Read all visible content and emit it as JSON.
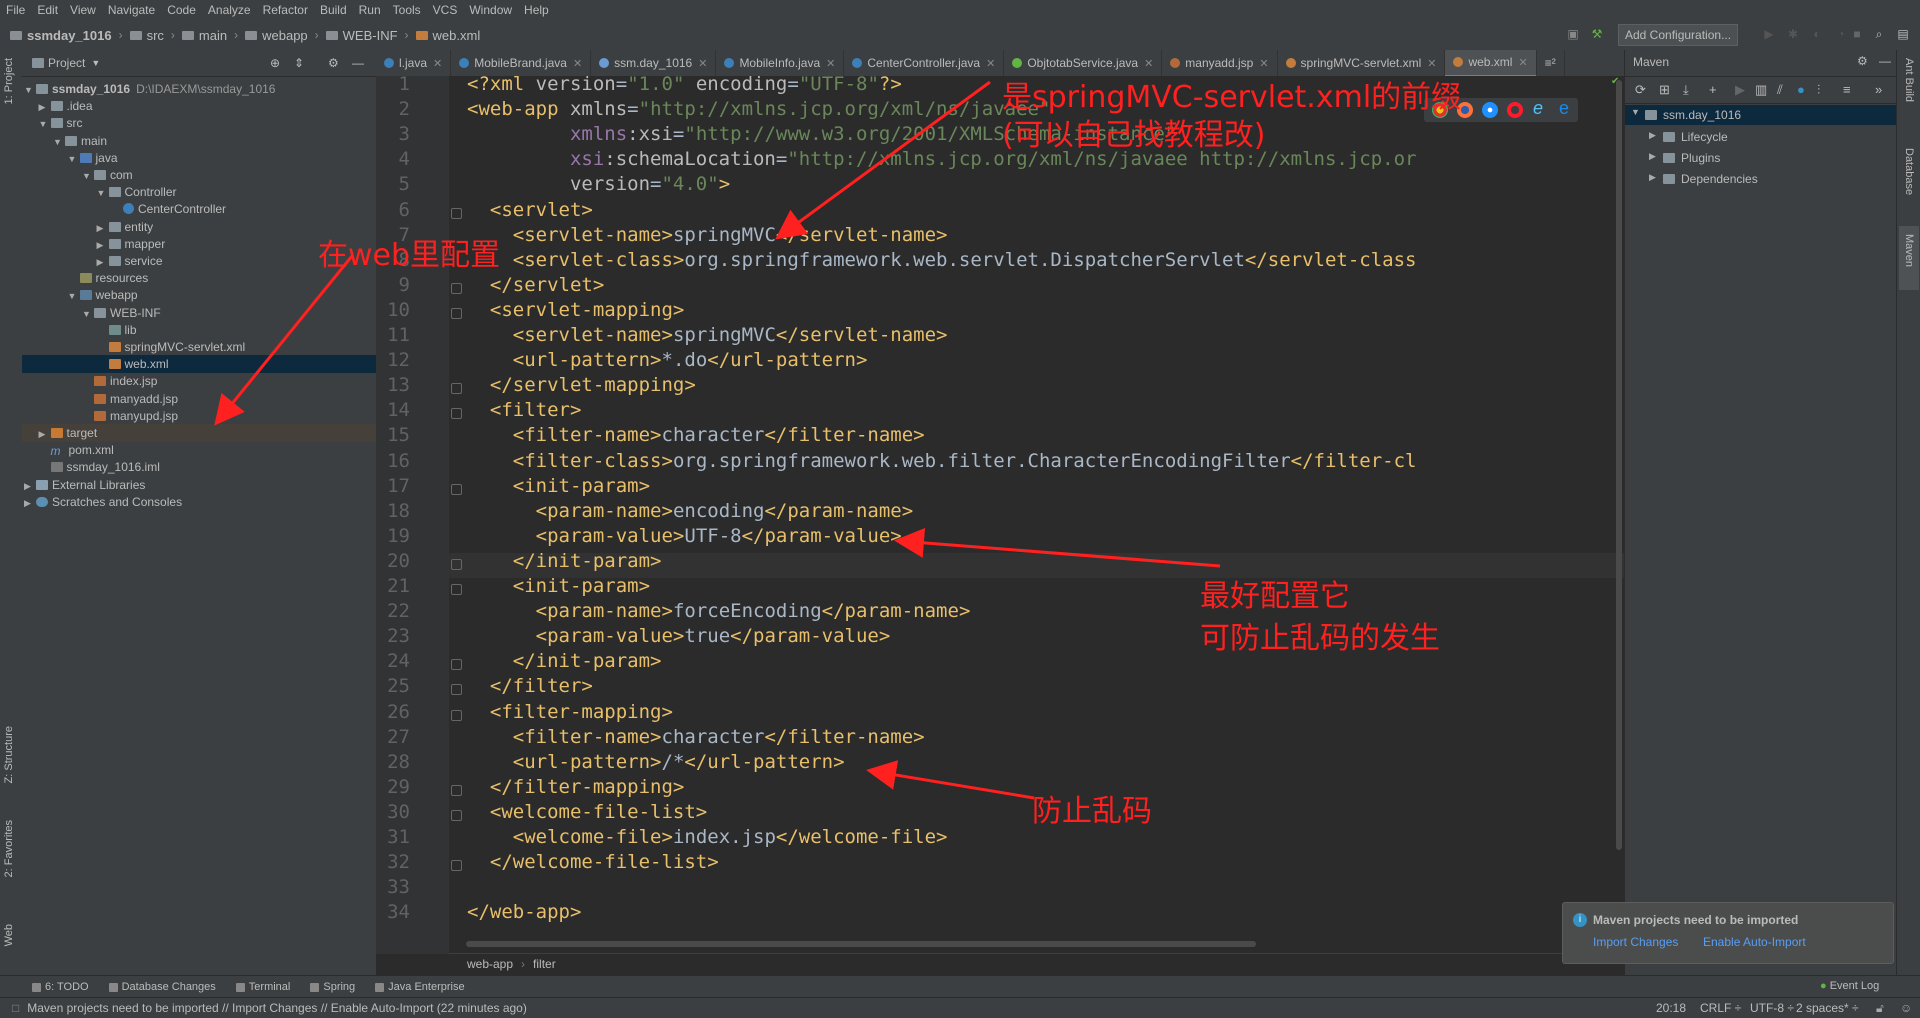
{
  "menu": [
    "File",
    "Edit",
    "View",
    "Navigate",
    "Code",
    "Analyze",
    "Refactor",
    "Build",
    "Run",
    "Tools",
    "VCS",
    "Window",
    "Help"
  ],
  "nav": {
    "project": "ssmday_1016",
    "crumbs": [
      "src",
      "main",
      "webapp",
      "WEB-INF",
      "web.xml"
    ],
    "add_config": "Add Configuration..."
  },
  "project_panel": {
    "title": "Project",
    "tree": [
      {
        "label": "ssmday_1016",
        "extra": "D:\\IDAEXM\\ssmday_1016",
        "depth": 0,
        "arrow": "▼",
        "icon": "folder",
        "bold": true
      },
      {
        "label": ".idea",
        "depth": 1,
        "arrow": "▶",
        "icon": "folder"
      },
      {
        "label": "src",
        "depth": 1,
        "arrow": "▼",
        "icon": "folder"
      },
      {
        "label": "main",
        "depth": 2,
        "arrow": "▼",
        "icon": "folder"
      },
      {
        "label": "java",
        "depth": 3,
        "arrow": "▼",
        "icon": "src"
      },
      {
        "label": "com",
        "depth": 4,
        "arrow": "▼",
        "icon": "folder"
      },
      {
        "label": "Controller",
        "depth": 5,
        "arrow": "▼",
        "icon": "folder"
      },
      {
        "label": "CenterController",
        "depth": 6,
        "arrow": "",
        "icon": "class"
      },
      {
        "label": "entity",
        "depth": 5,
        "arrow": "▶",
        "icon": "folder"
      },
      {
        "label": "mapper",
        "depth": 5,
        "arrow": "▶",
        "icon": "folder"
      },
      {
        "label": "service",
        "depth": 5,
        "arrow": "▶",
        "icon": "folder"
      },
      {
        "label": "resources",
        "depth": 3,
        "arrow": "",
        "icon": "res"
      },
      {
        "label": "webapp",
        "depth": 3,
        "arrow": "▼",
        "icon": "web"
      },
      {
        "label": "WEB-INF",
        "depth": 4,
        "arrow": "▼",
        "icon": "folder"
      },
      {
        "label": "lib",
        "depth": 5,
        "arrow": "",
        "icon": "lib"
      },
      {
        "label": "springMVC-servlet.xml",
        "depth": 5,
        "arrow": "",
        "icon": "xml"
      },
      {
        "label": "web.xml",
        "depth": 5,
        "arrow": "",
        "icon": "xml",
        "selected": true
      },
      {
        "label": "index.jsp",
        "depth": 4,
        "arrow": "",
        "icon": "jsp"
      },
      {
        "label": "manyadd.jsp",
        "depth": 4,
        "arrow": "",
        "icon": "jsp"
      },
      {
        "label": "manyupd.jsp",
        "depth": 4,
        "arrow": "",
        "icon": "jsp"
      },
      {
        "label": "target",
        "depth": 1,
        "arrow": "▶",
        "icon": "target",
        "highlight": true
      },
      {
        "label": "pom.xml",
        "depth": 1,
        "arrow": "",
        "icon": "pom"
      },
      {
        "label": "ssmday_1016.iml",
        "depth": 1,
        "arrow": "",
        "icon": "iml"
      },
      {
        "label": "External Libraries",
        "depth": 0,
        "arrow": "▶",
        "icon": "extlib"
      },
      {
        "label": "Scratches and Consoles",
        "depth": 0,
        "arrow": "▶",
        "icon": "scratch"
      }
    ]
  },
  "tabs": [
    {
      "label": "l.java",
      "color": "#3d7fb8"
    },
    {
      "label": "MobileBrand.java",
      "color": "#3d7fb8"
    },
    {
      "label": "ssm.day_1016",
      "color": "#6b9bd2"
    },
    {
      "label": "MobileInfo.java",
      "color": "#3d7fb8"
    },
    {
      "label": "CenterController.java",
      "color": "#3d7fb8"
    },
    {
      "label": "ObjtotabService.java",
      "color": "#62b543"
    },
    {
      "label": "manyadd.jsp",
      "color": "#b36a3a"
    },
    {
      "label": "springMVC-servlet.xml",
      "color": "#c27d3e"
    },
    {
      "label": "web.xml",
      "color": "#c27d3e",
      "active": true
    }
  ],
  "code_lines": [
    "<?xml version=\"1.0\" encoding=\"UTF-8\"?>",
    "<web-app xmlns=\"http://xmlns.jcp.org/xml/ns/javaee\"",
    "         xmlns:xsi=\"http://www.w3.org/2001/XMLSchema-instance\"",
    "         xsi:schemaLocation=\"http://xmlns.jcp.org/xml/ns/javaee http://xmlns.jcp.or",
    "         version=\"4.0\">",
    "  <servlet>",
    "    <servlet-name>springMVC</servlet-name>",
    "    <servlet-class>org.springframework.web.servlet.DispatcherServlet</servlet-class",
    "  </servlet>",
    "  <servlet-mapping>",
    "    <servlet-name>springMVC</servlet-name>",
    "    <url-pattern>*.do</url-pattern>",
    "  </servlet-mapping>",
    "  <filter>",
    "    <filter-name>character</filter-name>",
    "    <filter-class>org.springframework.web.filter.CharacterEncodingFilter</filter-cl",
    "    <init-param>",
    "      <param-name>encoding</param-name>",
    "      <param-value>UTF-8</param-value>",
    "    </init-param>",
    "    <init-param>",
    "      <param-name>forceEncoding</param-name>",
    "      <param-value>true</param-value>",
    "    </init-param>",
    "  </filter>",
    "  <filter-mapping>",
    "    <filter-name>character</filter-name>",
    "    <url-pattern>/*</url-pattern>",
    "  </filter-mapping>",
    "  <welcome-file-list>",
    "    <welcome-file>index.jsp</welcome-file>",
    "  </welcome-file-list>",
    "",
    "</web-app>"
  ],
  "editor_breadcrumb": [
    "web-app",
    "filter"
  ],
  "maven": {
    "title": "Maven",
    "root": "ssm.day_1016",
    "children": [
      "Lifecycle",
      "Plugins",
      "Dependencies"
    ]
  },
  "right_strip": [
    "Ant Build",
    "Database",
    "Maven"
  ],
  "left_strip": [
    "1: Project",
    "Z: Structure",
    "2: Favorites",
    "Web"
  ],
  "tool_windows": [
    "6: TODO",
    "Database Changes",
    "Terminal",
    "Spring",
    "Java Enterprise"
  ],
  "event_log": "Event Log",
  "notification": {
    "title": "Maven projects need to be imported",
    "link1": "Import Changes",
    "link2": "Enable Auto-Import"
  },
  "status": {
    "message": "Maven projects need to be imported // Import Changes // Enable Auto-Import (22 minutes ago)",
    "position": "20:18",
    "line_sep": "CRLF ÷",
    "encoding": "UTF-8 ÷",
    "indent": "2 spaces* ÷"
  },
  "annotations": {
    "prefix_note_1": "是springMVC-servlet.xml的前缀",
    "prefix_note_2": "(可以自己找教程改)",
    "web_note": "在web里配置",
    "encoding_note_1": "最好配置它",
    "encoding_note_2": "可防止乱码的发生",
    "garble_note": "防止乱码"
  },
  "colors": {
    "annotation": "#ff2020",
    "tag": "#e8bf6a",
    "attr_value": "#6a8759",
    "namespace": "#9876aa",
    "text": "#a9b7c6"
  }
}
